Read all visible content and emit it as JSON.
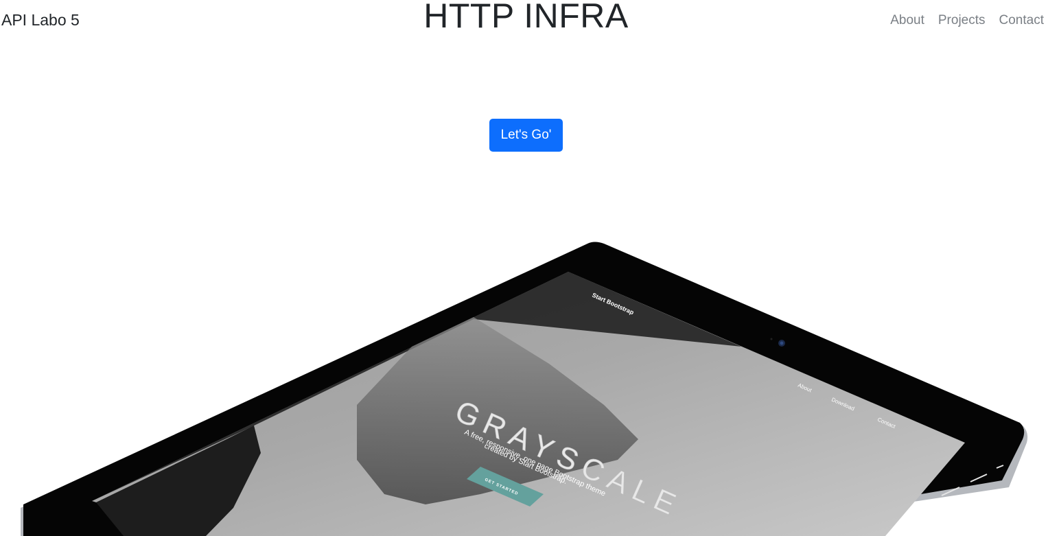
{
  "header": {
    "brand": "API Labo 5",
    "title": "HTTP INFRA",
    "nav": [
      "About",
      "Projects",
      "Contact"
    ]
  },
  "hero": {
    "cta_label": "Let's Go'"
  },
  "device_screen": {
    "brand": "Start Bootstrap",
    "nav": [
      "About",
      "Download",
      "Contact"
    ],
    "heading": "GRAYSCALE",
    "subtitle_line1": "A free, responsive, one page Bootstrap theme",
    "subtitle_line2": "created by Start Bootstrap.",
    "button": "GET STARTED"
  },
  "colors": {
    "accent": "#0d6efd",
    "nav_text": "#7a7f85",
    "mock_button": "#64a19d"
  }
}
